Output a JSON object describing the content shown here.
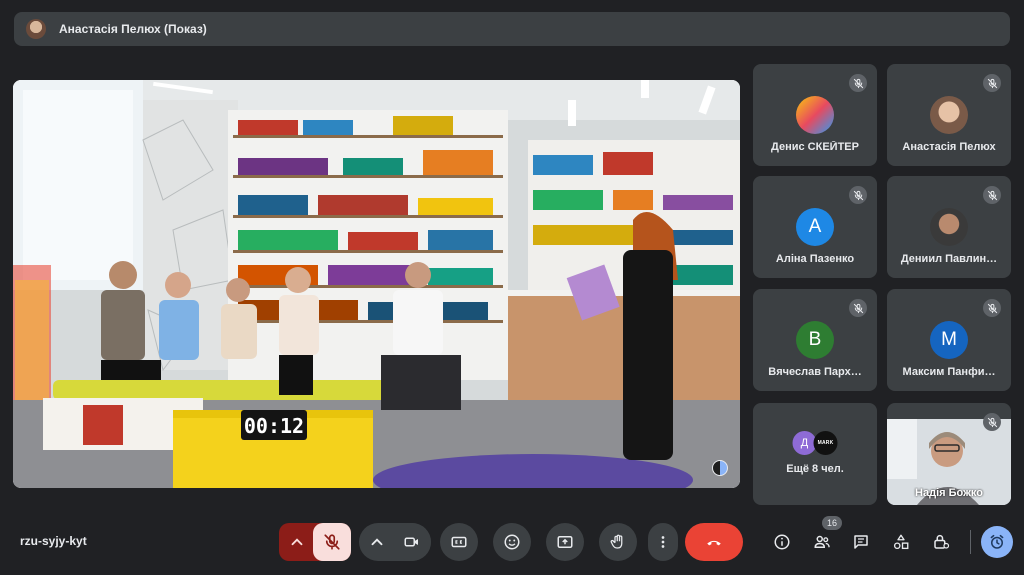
{
  "presenter_bar": {
    "title": "Анастасія Пелюх (Показ)"
  },
  "stage": {
    "timer_text": "00:12"
  },
  "participants": [
    {
      "name": "Денис СКЕЙТЕР",
      "muted": true
    },
    {
      "name": "Анастасія Пелюх",
      "muted": true
    },
    {
      "name": "Аліна Пазенко",
      "initial": "А",
      "color": "#1e88e5",
      "muted": true
    },
    {
      "name": "Дениил Павлин…",
      "muted": true
    },
    {
      "name": "Вячеслав Парх…",
      "initial": "В",
      "color": "#2e7d32",
      "muted": true
    },
    {
      "name": "Максим Панфи…",
      "initial": "M",
      "color": "#1565c0",
      "muted": true
    },
    {
      "name": "Надія Божко",
      "muted": true
    }
  ],
  "more_participants": {
    "label": "Ещё 8 чел.",
    "chip_initial": "Д",
    "chip_color": "#8e6bd6",
    "logo_text": "MARK"
  },
  "footer": {
    "meeting_code": "rzu-syjy-kyt",
    "people_count": "16"
  },
  "colors": {
    "background": "#202124",
    "surface": "#3c4043",
    "mic_off_red": "#f28b82",
    "mic_off_bg": "#f9dedc",
    "end_call": "#ea4335",
    "accent": "#8ab4f8"
  },
  "icons": {
    "controls": [
      "chevron-up-icon",
      "mic-off-icon",
      "chevron-up-icon",
      "camera-icon",
      "captions-icon",
      "emoji-icon",
      "present-icon",
      "raise-hand-icon",
      "more-vert-icon",
      "end-call-icon"
    ],
    "side": [
      "info-icon",
      "people-icon",
      "chat-icon",
      "activities-icon",
      "host-controls-icon",
      "timer-icon"
    ]
  }
}
